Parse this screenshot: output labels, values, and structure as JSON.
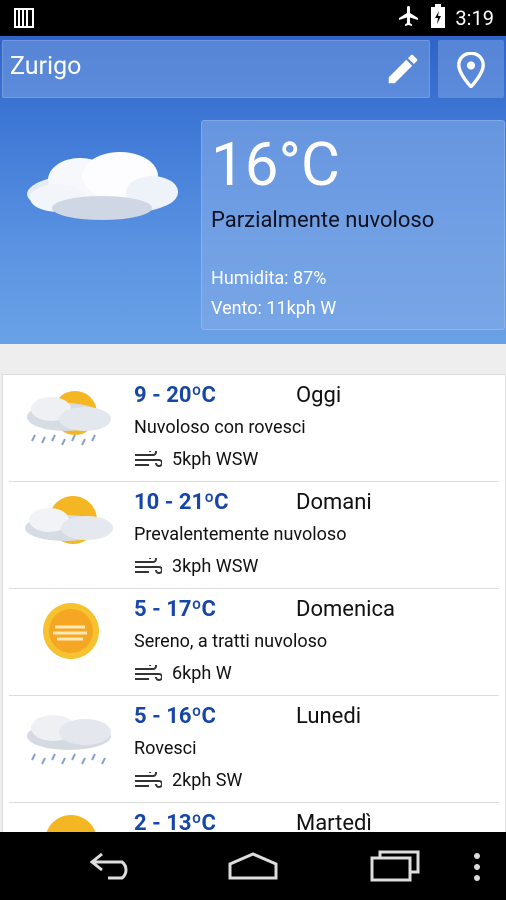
{
  "status_bar": {
    "time": "3:19"
  },
  "search": {
    "city": "Zurigo"
  },
  "current": {
    "temperature": "16°C",
    "condition": "Parzialmente nuvoloso",
    "humidity": "Humidita: 87%",
    "wind": "Vento: 11kph W"
  },
  "forecast": [
    {
      "range": "9 - 20ºC",
      "day": "Oggi",
      "desc": "Nuvoloso con rovesci",
      "wind": "5kph  WSW",
      "icon": "cloudy-showers-icon"
    },
    {
      "range": "10 - 21ºC",
      "day": "Domani",
      "desc": "Prevalentemente nuvoloso",
      "wind": "3kph  WSW",
      "icon": "mostly-cloudy-icon"
    },
    {
      "range": "5 - 17ºC",
      "day": "Domenica",
      "desc": "Sereno, a tratti nuvoloso",
      "wind": "6kph  W",
      "icon": "sunny-hazy-icon"
    },
    {
      "range": "5 - 16ºC",
      "day": "Lunedi",
      "desc": "Rovesci",
      "wind": "2kph  SW",
      "icon": "showers-icon"
    },
    {
      "range": "2 - 13ºC",
      "day": "Martedì",
      "desc": "",
      "wind": "",
      "icon": "sunny-icon"
    }
  ],
  "colors": {
    "sky_top": "#2f63c8",
    "temp_range": "#1745a8",
    "sun": "#f5b623"
  }
}
